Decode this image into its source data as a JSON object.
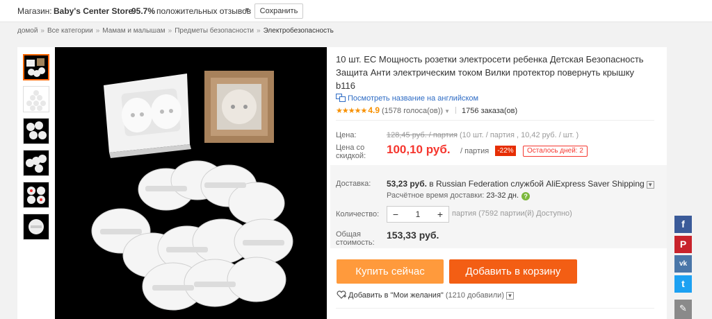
{
  "store": {
    "label": "Магазин:",
    "name": "Baby's Center Store",
    "rating": "95.7%",
    "feedback": "положительных отзывов",
    "save_label": "Сохранить"
  },
  "breadcrumb": [
    "домой",
    "Все категории",
    "Мамам и малышам",
    "Предметы безопасности",
    "Электробезопасность"
  ],
  "product": {
    "title": "10 шт. ЕС Мощность розетки электросети ребенка Детская Безопасность Защита Анти электрическим током Вилки протектор повернуть крышку b116",
    "translate_link": "Посмотреть название на английском",
    "rating_value": "4.9",
    "votes": "(1578 голоса(ов))",
    "orders": "1756 заказа(ов)"
  },
  "price": {
    "price_label": "Цена:",
    "old_price": "128,45 руб. / партия",
    "old_price_extra": " (10 шт. / партия , 10,42 руб. / шт. )",
    "discount_label_1": "Цена со",
    "discount_label_2": "скидкой:",
    "new_price": "100,10 руб.",
    "unit": "/ партия",
    "discount": "-22%",
    "days_left": "Осталось дней: 2"
  },
  "shipping": {
    "label": "Доставка:",
    "price": "53,23 руб.",
    "to": " в Russian Federation службой AliExpress Saver Shipping",
    "time_label": "Расчётное время доставки:",
    "time_value": "23-32 дн."
  },
  "quantity": {
    "label": "Количество:",
    "value": "1",
    "info": "партия (7592 партии(й) Доступно)"
  },
  "total": {
    "label_1": "Общая",
    "label_2": "стоимость:",
    "value": "153,33 руб."
  },
  "buttons": {
    "buy": "Купить сейчас",
    "cart": "Добавить в корзину"
  },
  "wishlist": {
    "label": "Добавить в \"Мои желания\"",
    "count": "(1210 добавили)"
  },
  "social": {
    "facebook": "f",
    "pinterest": "P",
    "vk": "vk",
    "twitter": "t",
    "edit": "✎"
  },
  "colors": {
    "price_red": "#f5362e",
    "buy_orange": "#ff9a3c",
    "cart_orange": "#f35e14",
    "link_blue": "#2d6bc4"
  }
}
